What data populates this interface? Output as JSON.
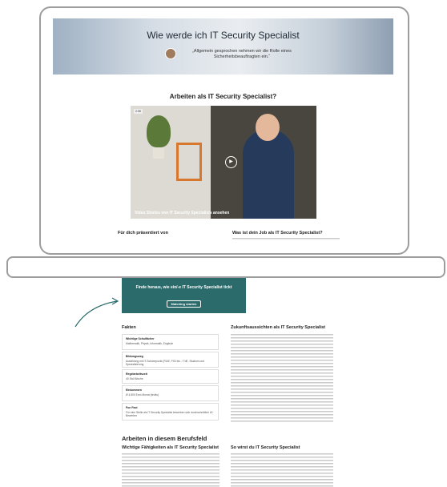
{
  "hero": {
    "title": "Wie werde ich IT Security Specialist",
    "quote": "„Allgemein gesprochen nehmen wir die Rolle eines Sicherheitsbeauftragten ein.“"
  },
  "section": {
    "title": "Arbeiten als IT Security Specialist?"
  },
  "video": {
    "caption": "Video Stories von IT Security Specialists ansehen",
    "tag": "2:35"
  },
  "columns": {
    "left_title": "Für dich präsentiert von",
    "right_title": "Was ist dein Job als IT Security Specialist?"
  },
  "cta": {
    "text": "Finde heraus, wie ein/-e IT Security Specialist tickt",
    "button": "Matching starten"
  },
  "fakten": {
    "title": "Fakten",
    "cards": [
      {
        "k": "Wichtige Schulfächer",
        "v": "Mathematik, Physik, Informatik, Englisch"
      },
      {
        "k": "Bildungsweg",
        "v": "Ausbildung mit IT-Schwerpunkt (FIAE, FISI etc. / TdE, Studium und Spezialisierung"
      },
      {
        "k": "Regelarbeitszeit",
        "v": "40 Std./Woche"
      },
      {
        "k": "Einkommen",
        "v": "Ø 4.800 Euro Monat (brutto)"
      },
      {
        "k": "Fun Fact",
        "v": "Für eine Stelle als IT Security Specialist bewerben sich durchschnittlich 40 Bewerber"
      }
    ]
  },
  "zukunft": {
    "title": "Zukunftsaussichten als IT Security Specialist"
  },
  "bottom": {
    "title": "Arbeiten in diesem Berufsfeld",
    "left_sub": "Wichtige Fähigkeiten als IT Security Specialist",
    "right_sub": "So wirst du IT Security Specialist"
  },
  "colors": {
    "cta": "#2b6b6b",
    "frame": "#9d9d9d"
  }
}
